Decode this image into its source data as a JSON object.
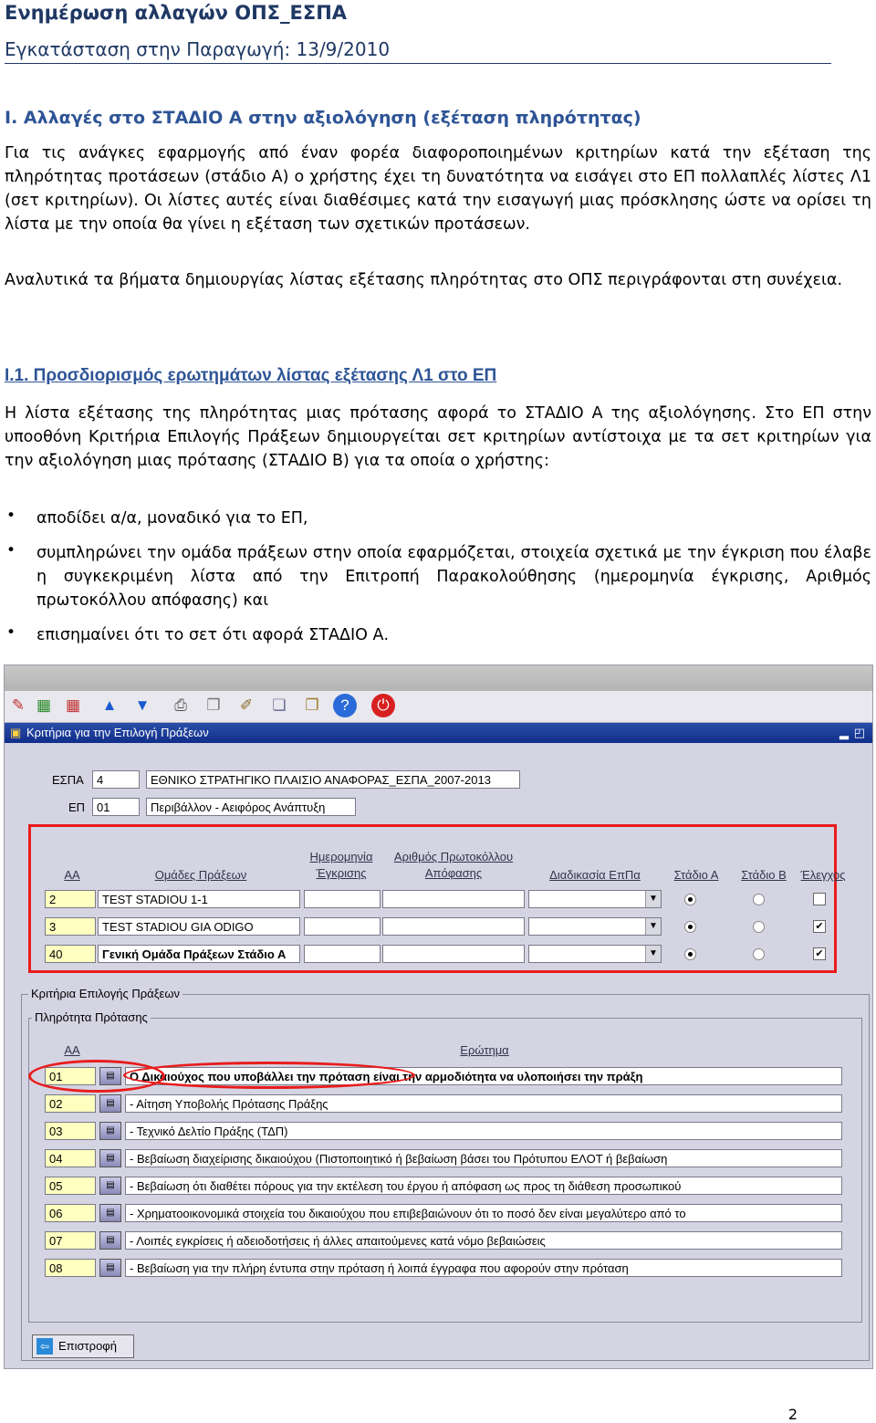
{
  "doc": {
    "title": "Ενημέρωση αλλαγών ΟΠΣ_ΕΣΠΑ",
    "subtitle": "Εγκατάσταση στην Παραγωγή:  13/9/2010",
    "section": "Ι. Αλλαγές στο ΣΤΑΔΙΟ Α στην αξιολόγηση (εξέταση πληρότητας)",
    "p1": "Για τις ανάγκες εφαρμογής από έναν φορέα διαφοροποιημένων κριτηρίων κατά την εξέταση της πληρότητας προτάσεων (στάδιο Α) ο χρήστης έχει τη δυνατότητα να εισάγει στο ΕΠ πολλαπλές λίστες Λ1 (σετ κριτηρίων). Οι λίστες αυτές είναι διαθέσιμες κατά την εισαγωγή μιας πρόσκλησης ώστε να ορίσει τη λίστα με την οποία θα γίνει η εξέταση των σχετικών προτάσεων.",
    "p2": "Αναλυτικά τα βήματα δημιουργίας λίστας εξέτασης πληρότητας στο ΟΠΣ περιγράφονται στη συνέχεια.",
    "subsection": "Ι.1. Προσδιορισμός ερωτημάτων λίστας εξέτασης Λ1 στο ΕΠ",
    "p3": "Η λίστα εξέτασης της πληρότητας μιας πρότασης αφορά το ΣΤΑΔΙΟ Α της αξιολόγησης. Στο ΕΠ στην υποοθόνη Κριτήρια Επιλογής Πράξεων δημιουργείται σετ κριτηρίων αντίστοιχα με τα σετ κριτηρίων για την αξιολόγηση μιας πρότασης (ΣΤΑΔΙΟ Β) για τα οποία ο χρήστης:",
    "bullets": [
      "αποδίδει α/α, μοναδικό για το ΕΠ,",
      "συμπληρώνει την ομάδα πράξεων στην οποία εφαρμόζεται, στοιχεία σχετικά με την έγκριση που έλαβε η συγκεκριμένη λίστα από την Επιτροπή Παρακολούθησης (ημερομηνία έγκρισης, Αριθμός πρωτοκόλλου απόφασης) και",
      "επισημαίνει ότι το σετ ότι αφορά ΣΤΑΔΙΟ Α."
    ],
    "bullet_glyph": "•",
    "page_number": "2"
  },
  "screen": {
    "window_title": "Κριτήρια για την Επιλογή Πράξεων",
    "espa_label": "ΕΣΠΑ",
    "espa_code": "4",
    "espa_name": "ΕΘΝΙΚΟ ΣΤΡΑΤΗΓΙΚΟ ΠΛΑΙΣΙΟ ΑΝΑΦΟΡΑΣ_ΕΣΠΑ_2007-2013",
    "ep_label": "ΕΠ",
    "ep_code": "01",
    "ep_name": "Περιβάλλον - Αειφόρος Ανάπτυξη",
    "cols": {
      "aa": "ΑΑ",
      "groups": "Ομάδες Πράξεων",
      "approval_date": "Ημερομηνία Έγκρισης",
      "protocol": "Αριθμός Πρωτοκόλλου Απόφασης",
      "procedure": "Διαδικασία ΕπΠα",
      "stage_a": "Στάδιο Α",
      "stage_b": "Στάδιο Β",
      "check": "Έλεγχος"
    },
    "sets": [
      {
        "aa": "2",
        "group": "TEST STADIOU 1-1",
        "stage_a": true,
        "stage_b": false,
        "check": false
      },
      {
        "aa": "3",
        "group": "TEST STADIOU GIA ODIGO",
        "stage_a": true,
        "stage_b": false,
        "check": true
      },
      {
        "aa": "40",
        "group": "Γενική Ομάδα Πράξεων Στάδιο Α",
        "stage_a": true,
        "stage_b": false,
        "check": true
      }
    ],
    "frame_outer": "Κριτήρια Επιλογής Πράξεων",
    "frame_inner": "Πληρότητα Πρότασης",
    "q_cols": {
      "aa": "ΑΑ",
      "question": "Ερώτημα"
    },
    "questions": [
      {
        "aa": "01",
        "text": "Ο Δικαιούχος που υποβάλλει την πρόταση είναι την αρμοδιότητα να υλοποιήσει την πράξη"
      },
      {
        "aa": "02",
        "text": "- Αίτηση Υποβολής Πρότασης Πράξης"
      },
      {
        "aa": "03",
        "text": "- Τεχνικό Δελτίο Πράξης (ΤΔΠ)"
      },
      {
        "aa": "04",
        "text": "- Βεβαίωση διαχείρισης δικαιούχου (Πιστοποιητικό ή βεβαίωση βάσει του Πρότυπου ΕΛΟΤ ή βεβαίωση"
      },
      {
        "aa": "05",
        "text": "- Βεβαίωση ότι διαθέτει πόρους για την εκτέλεση του έργου ή απόφαση ως προς τη διάθεση προσωπικού"
      },
      {
        "aa": "06",
        "text": "- Χρηματοοικονομικά στοιχεία του δικαιούχου που επιβεβαιώνουν ότι το ποσό δεν είναι μεγαλύτερο από το"
      },
      {
        "aa": "07",
        "text": "- Λοιπές εγκρίσεις ή αδειοδοτήσεις ή άλλες απαιτούμενες κατά νόμο βεβαιώσεις"
      },
      {
        "aa": "08",
        "text": "- Βεβαίωση για την πλήρη έντυπα στην πρόταση ή λοιπά έγγραφα που αφορούν στην πρόταση"
      }
    ],
    "return_label": "Επιστροφή",
    "highlight_color": "#e81c1c",
    "title_bar_color": "#1a3a9a"
  }
}
